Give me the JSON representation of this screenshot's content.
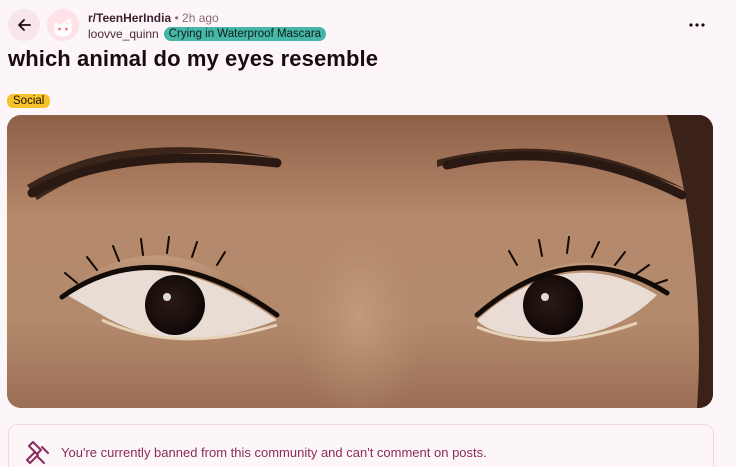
{
  "header": {
    "subreddit": "r/TeenHerIndia",
    "time_ago": "• 2h ago",
    "username": "loovve_quinn",
    "user_flair": "Crying in Waterproof Mascara",
    "back_icon": "arrow-left-icon",
    "more_icon": "more-horizontal-icon"
  },
  "post": {
    "title": "which animal do my eyes resemble",
    "flair": "Social",
    "image_subject": "close-up photo of a person's eyes and eyebrows"
  },
  "notice": {
    "icon": "ban-hammer-icon",
    "text": "You're currently banned from this community and can't comment on posts."
  },
  "colors": {
    "background": "#fdf6f9",
    "user_flair_bg": "#46b6a6",
    "post_flair_bg": "#f6c32b",
    "notice_text": "#8b2a5e"
  }
}
